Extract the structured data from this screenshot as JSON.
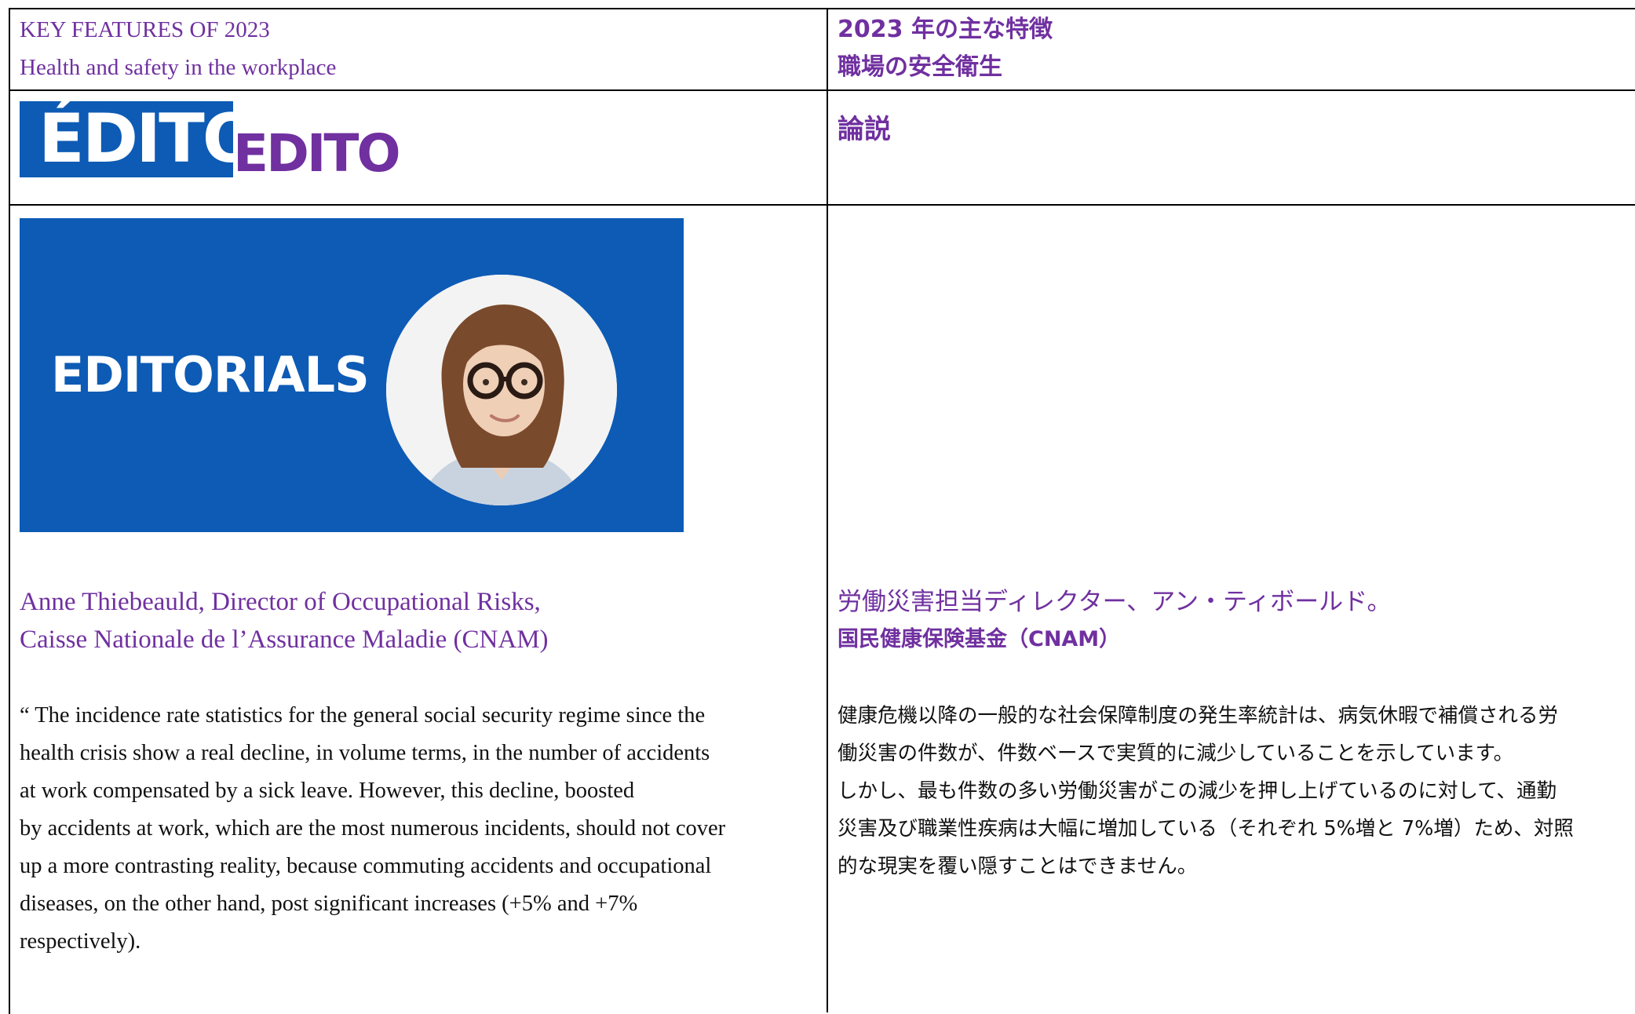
{
  "header": {
    "en_line1": "KEY FEATURES OF 2023",
    "en_line2": "Health and safety in the workplace",
    "jp_line1": "2023 年の主な特徴",
    "jp_line2": "職場の安全衛生"
  },
  "section": {
    "badge": "ÉDITO",
    "word": "EDITO",
    "jp": "論説"
  },
  "banner": {
    "label": "EDITORIALS",
    "brand_blue": "#0d5bb5"
  },
  "author": {
    "en_line1": "Anne Thiebeauld, Director of Occupational Risks,",
    "en_line2": "Caisse Nationale de l’Assurance Maladie (CNAM)",
    "jp_line1": "労働災害担当ディレクター、アン・ティボールド。",
    "jp_line2": "国民健康保険基金（CNAM）"
  },
  "body": {
    "en_lines": [
      "“ The incidence rate statistics for the general social security regime since the",
      "health crisis show a real decline, in volume terms, in the number of accidents",
      "at work compensated by a sick leave. However, this decline, boosted",
      "by accidents at work, which are the most numerous incidents, should not cover",
      "up a more contrasting reality, because commuting accidents and occupational",
      "diseases, on the other hand, post significant increases (+5% and +7%",
      "respectively)."
    ],
    "jp_lines": [
      "健康危機以降の一般的な社会保障制度の発生率統計は、病気休暇で補償される労",
      "働災害の件数が、件数ベースで実質的に減少していることを示しています。",
      "しかし、最も件数の多い労働災害がこの減少を押し上げているのに対して、通勤",
      "災害及び職業性疾病は大幅に増加している（それぞれ 5%増と 7%増）ため、対照",
      "的な現実を覆い隠すことはできません。"
    ]
  },
  "colors": {
    "accent_purple": "#7030a0",
    "text": "#111111"
  }
}
